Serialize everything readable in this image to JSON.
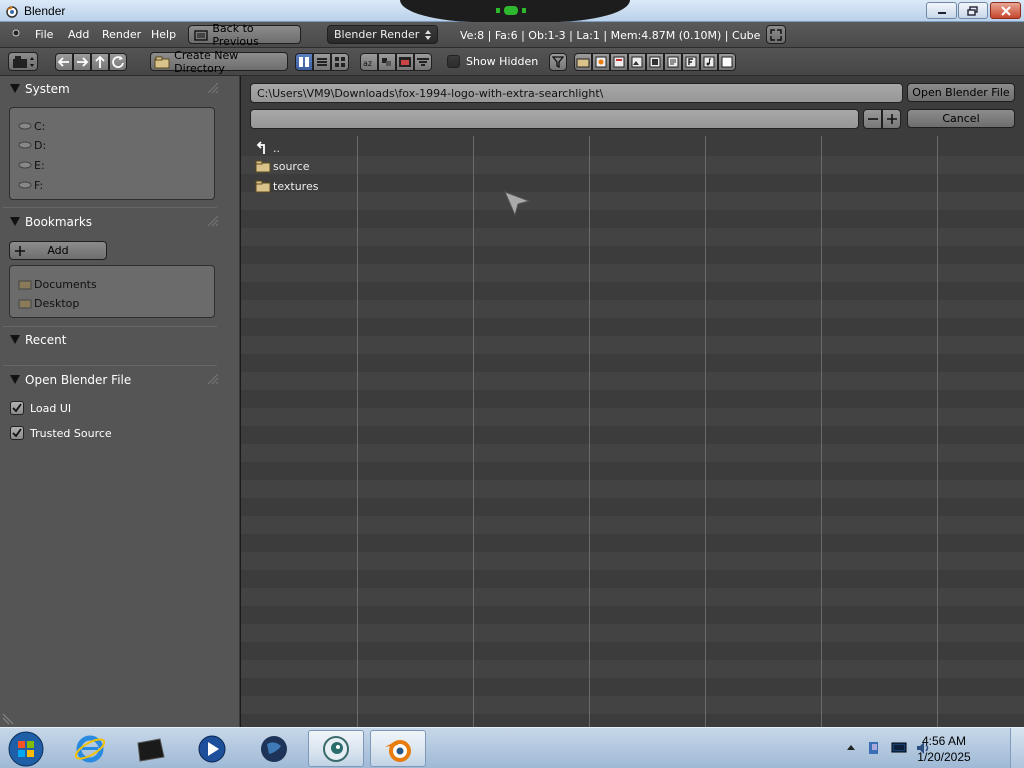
{
  "window": {
    "title": "Blender"
  },
  "menu": {
    "items": [
      "File",
      "Add",
      "Render",
      "Help"
    ]
  },
  "info_header": {
    "back_label": "Back to Previous",
    "engine": "Blender Render",
    "stats": "Ve:8 | Fa:6 | Ob:1-3 | La:1 | Mem:4.87M (0.10M) | Cube"
  },
  "toolbar": {
    "create_dir_label": "Create New Directory",
    "show_hidden_label": "Show Hidden",
    "show_hidden_checked": false
  },
  "sidebar": {
    "system": {
      "title": "System",
      "drives": [
        "C:",
        "D:",
        "E:",
        "F:"
      ]
    },
    "bookmarks": {
      "title": "Bookmarks",
      "add_label": "Add",
      "items": [
        "Documents",
        "Desktop"
      ]
    },
    "recent": {
      "title": "Recent"
    },
    "open_options": {
      "title": "Open Blender File",
      "load_ui": {
        "label": "Load UI",
        "checked": true
      },
      "trusted_source": {
        "label": "Trusted Source",
        "checked": true
      }
    }
  },
  "browser": {
    "path": "C:\\Users\\VM9\\Downloads\\fox-1994-logo-with-extra-searchlight\\",
    "filename": "",
    "open_button": "Open Blender File",
    "cancel_button": "Cancel",
    "files": [
      {
        "name": "..",
        "type": "parent"
      },
      {
        "name": "source",
        "type": "folder"
      },
      {
        "name": "textures",
        "type": "folder"
      }
    ]
  },
  "taskbar": {
    "apps": [
      "start-orb",
      "internet-explorer",
      "command-window",
      "media-player",
      "globe-app",
      "app-active",
      "blender"
    ],
    "time": "4:56 AM",
    "date": "1/20/2025"
  },
  "colors": {
    "accent_blue": "#5a7ec0",
    "panel_bg": "#555555",
    "browser_bg": "#3c3c3c"
  }
}
